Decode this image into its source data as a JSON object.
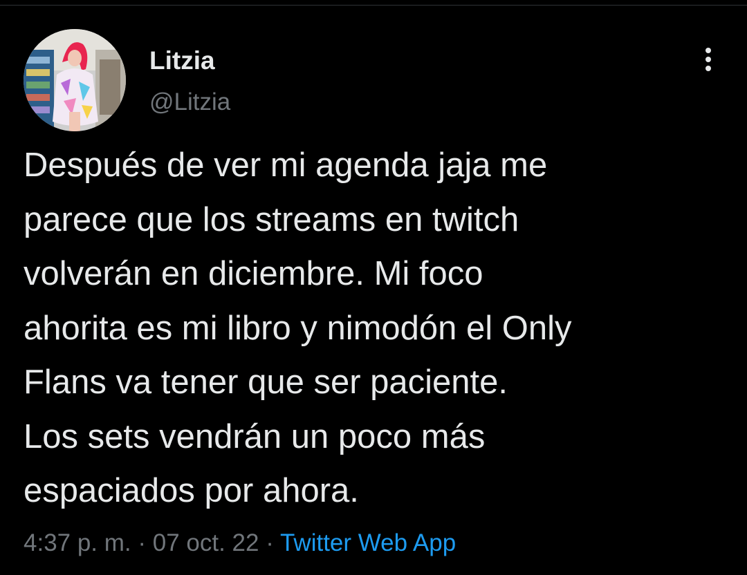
{
  "colors": {
    "background": "#000000",
    "text_primary": "#e7e9ea",
    "text_secondary": "#71767b",
    "link": "#1d9bf0"
  },
  "tweet": {
    "author": {
      "display_name": "Litzia",
      "handle": "@Litzia",
      "avatar_icon": "user-avatar"
    },
    "more_icon": "vertical-ellipsis-icon",
    "text_lines": [
      "Después de ver mi agenda jaja me",
      "parece que los streams en twitch",
      "volverán en diciembre. Mi foco",
      "ahorita es mi libro y nimodón el Only",
      "Flans va tener que ser paciente.",
      "Los sets vendrán un poco más",
      "espaciados por ahora."
    ],
    "meta": {
      "time": "4:37 p. m.",
      "separator": "·",
      "date": "07 oct. 22",
      "source": "Twitter Web App"
    }
  }
}
